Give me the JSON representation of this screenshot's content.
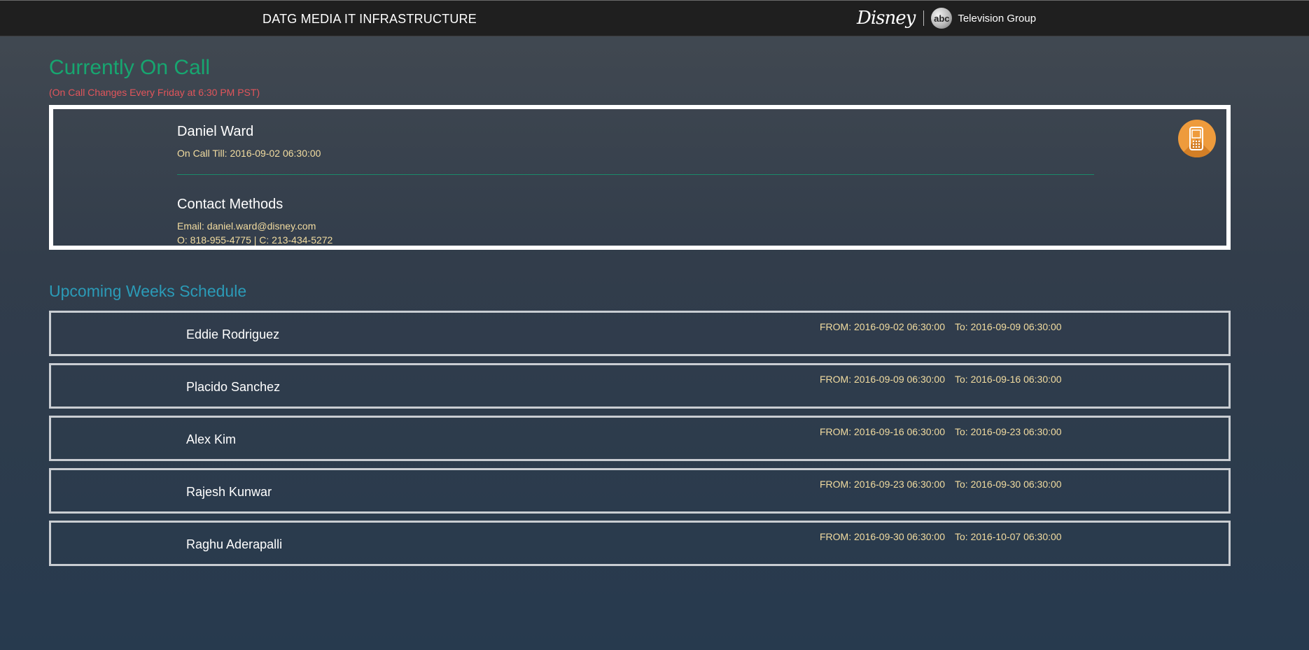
{
  "header": {
    "title": "DATG MEDIA IT INFRASTRUCTURE",
    "brand_disney": "Disney",
    "brand_abc": "abc",
    "brand_group": "Television Group"
  },
  "on_call": {
    "heading": "Currently On Call",
    "note": "(On Call Changes Every Friday at 6:30 PM PST)",
    "name": "Daniel Ward",
    "till": "On Call Till: 2016-09-02 06:30:00",
    "contact_title": "Contact Methods",
    "email": "Email: daniel.ward@disney.com",
    "phones": "O: 818-955-4775 | C: 213-434-5272",
    "phone_icon": "mobile-phone-icon",
    "phone_icon_color": "#ee9b3c"
  },
  "upcoming": {
    "heading": "Upcoming Weeks Schedule",
    "rows": [
      {
        "name": "Eddie Rodriguez",
        "from": "FROM: 2016-09-02 06:30:00",
        "to": "To: 2016-09-09 06:30:00"
      },
      {
        "name": "Placido Sanchez",
        "from": "FROM: 2016-09-09 06:30:00",
        "to": "To: 2016-09-16 06:30:00"
      },
      {
        "name": "Alex Kim",
        "from": "FROM: 2016-09-16 06:30:00",
        "to": "To: 2016-09-23 06:30:00"
      },
      {
        "name": "Rajesh Kunwar",
        "from": "FROM: 2016-09-23 06:30:00",
        "to": "To: 2016-09-30 06:30:00"
      },
      {
        "name": "Raghu Aderapalli",
        "from": "FROM: 2016-09-30 06:30:00",
        "to": "To: 2016-10-07 06:30:00"
      }
    ]
  },
  "colors": {
    "heading_green": "#17a670",
    "note_red": "#e1555b",
    "detail_text": "#f2dca0",
    "upcoming_blue": "#2b9bb7"
  }
}
